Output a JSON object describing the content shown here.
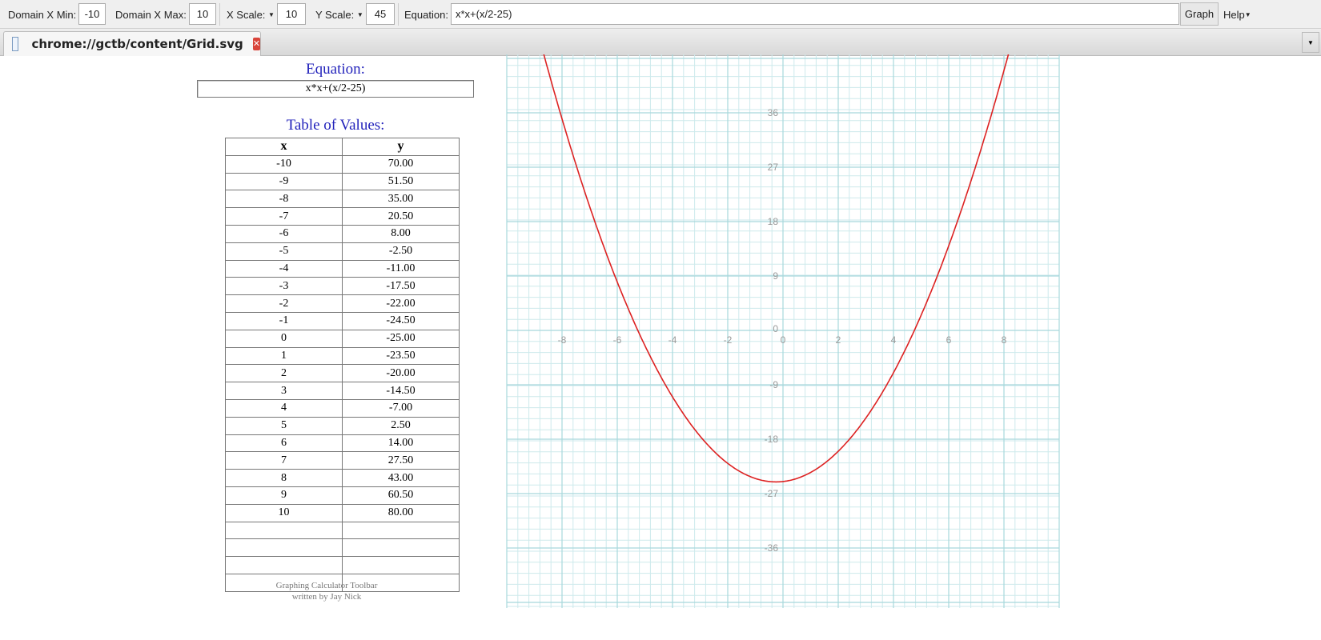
{
  "toolbar": {
    "xmin_label": "Domain X Min:",
    "xmin": "-10",
    "xmax_label": "Domain X Max:",
    "xmax": "10",
    "xscale_label": "X Scale:",
    "xscale": "10",
    "yscale_label": "Y Scale:",
    "yscale": "45",
    "equation_label": "Equation:",
    "equation": "x*x+(x/2-25)",
    "graph": "Graph",
    "help": "Help"
  },
  "tab": {
    "title": "chrome://gctb/content/Grid.svg",
    "icon": "document-icon",
    "close_icon": "close-icon"
  },
  "page": {
    "equation_heading": "Equation:",
    "equation": "x*x+(x/2-25)",
    "table_heading": "Table of Values:",
    "credit1": "Graphing Calculator Toolbar",
    "credit2": "written by Jay Nick"
  },
  "table": {
    "headers": [
      "x",
      "y"
    ],
    "rows": [
      [
        "-10",
        "70.00"
      ],
      [
        "-9",
        "51.50"
      ],
      [
        "-8",
        "35.00"
      ],
      [
        "-7",
        "20.50"
      ],
      [
        "-6",
        "8.00"
      ],
      [
        "-5",
        "-2.50"
      ],
      [
        "-4",
        "-11.00"
      ],
      [
        "-3",
        "-17.50"
      ],
      [
        "-2",
        "-22.00"
      ],
      [
        "-1",
        "-24.50"
      ],
      [
        "0",
        "-25.00"
      ],
      [
        "1",
        "-23.50"
      ],
      [
        "2",
        "-20.00"
      ],
      [
        "3",
        "-14.50"
      ],
      [
        "4",
        "-7.00"
      ],
      [
        "5",
        "2.50"
      ],
      [
        "6",
        "14.00"
      ],
      [
        "7",
        "27.50"
      ],
      [
        "8",
        "43.00"
      ],
      [
        "9",
        "60.50"
      ],
      [
        "10",
        "80.00"
      ],
      [
        "",
        ""
      ],
      [
        "",
        ""
      ],
      [
        "",
        ""
      ],
      [
        "",
        ""
      ]
    ]
  },
  "chart_data": {
    "type": "line",
    "equation": "x*x+(x/2-25)",
    "xlim": [
      -10,
      10
    ],
    "ylim": [
      -45,
      45
    ],
    "xticks": [
      -8,
      -6,
      -4,
      -2,
      0,
      2,
      4,
      6,
      8
    ],
    "yticks": [
      -36,
      -27,
      -18,
      -9,
      0,
      9,
      18,
      27,
      36
    ],
    "grid": true,
    "curve_color": "#dd2222",
    "grid_color": "#a8d8dc"
  }
}
